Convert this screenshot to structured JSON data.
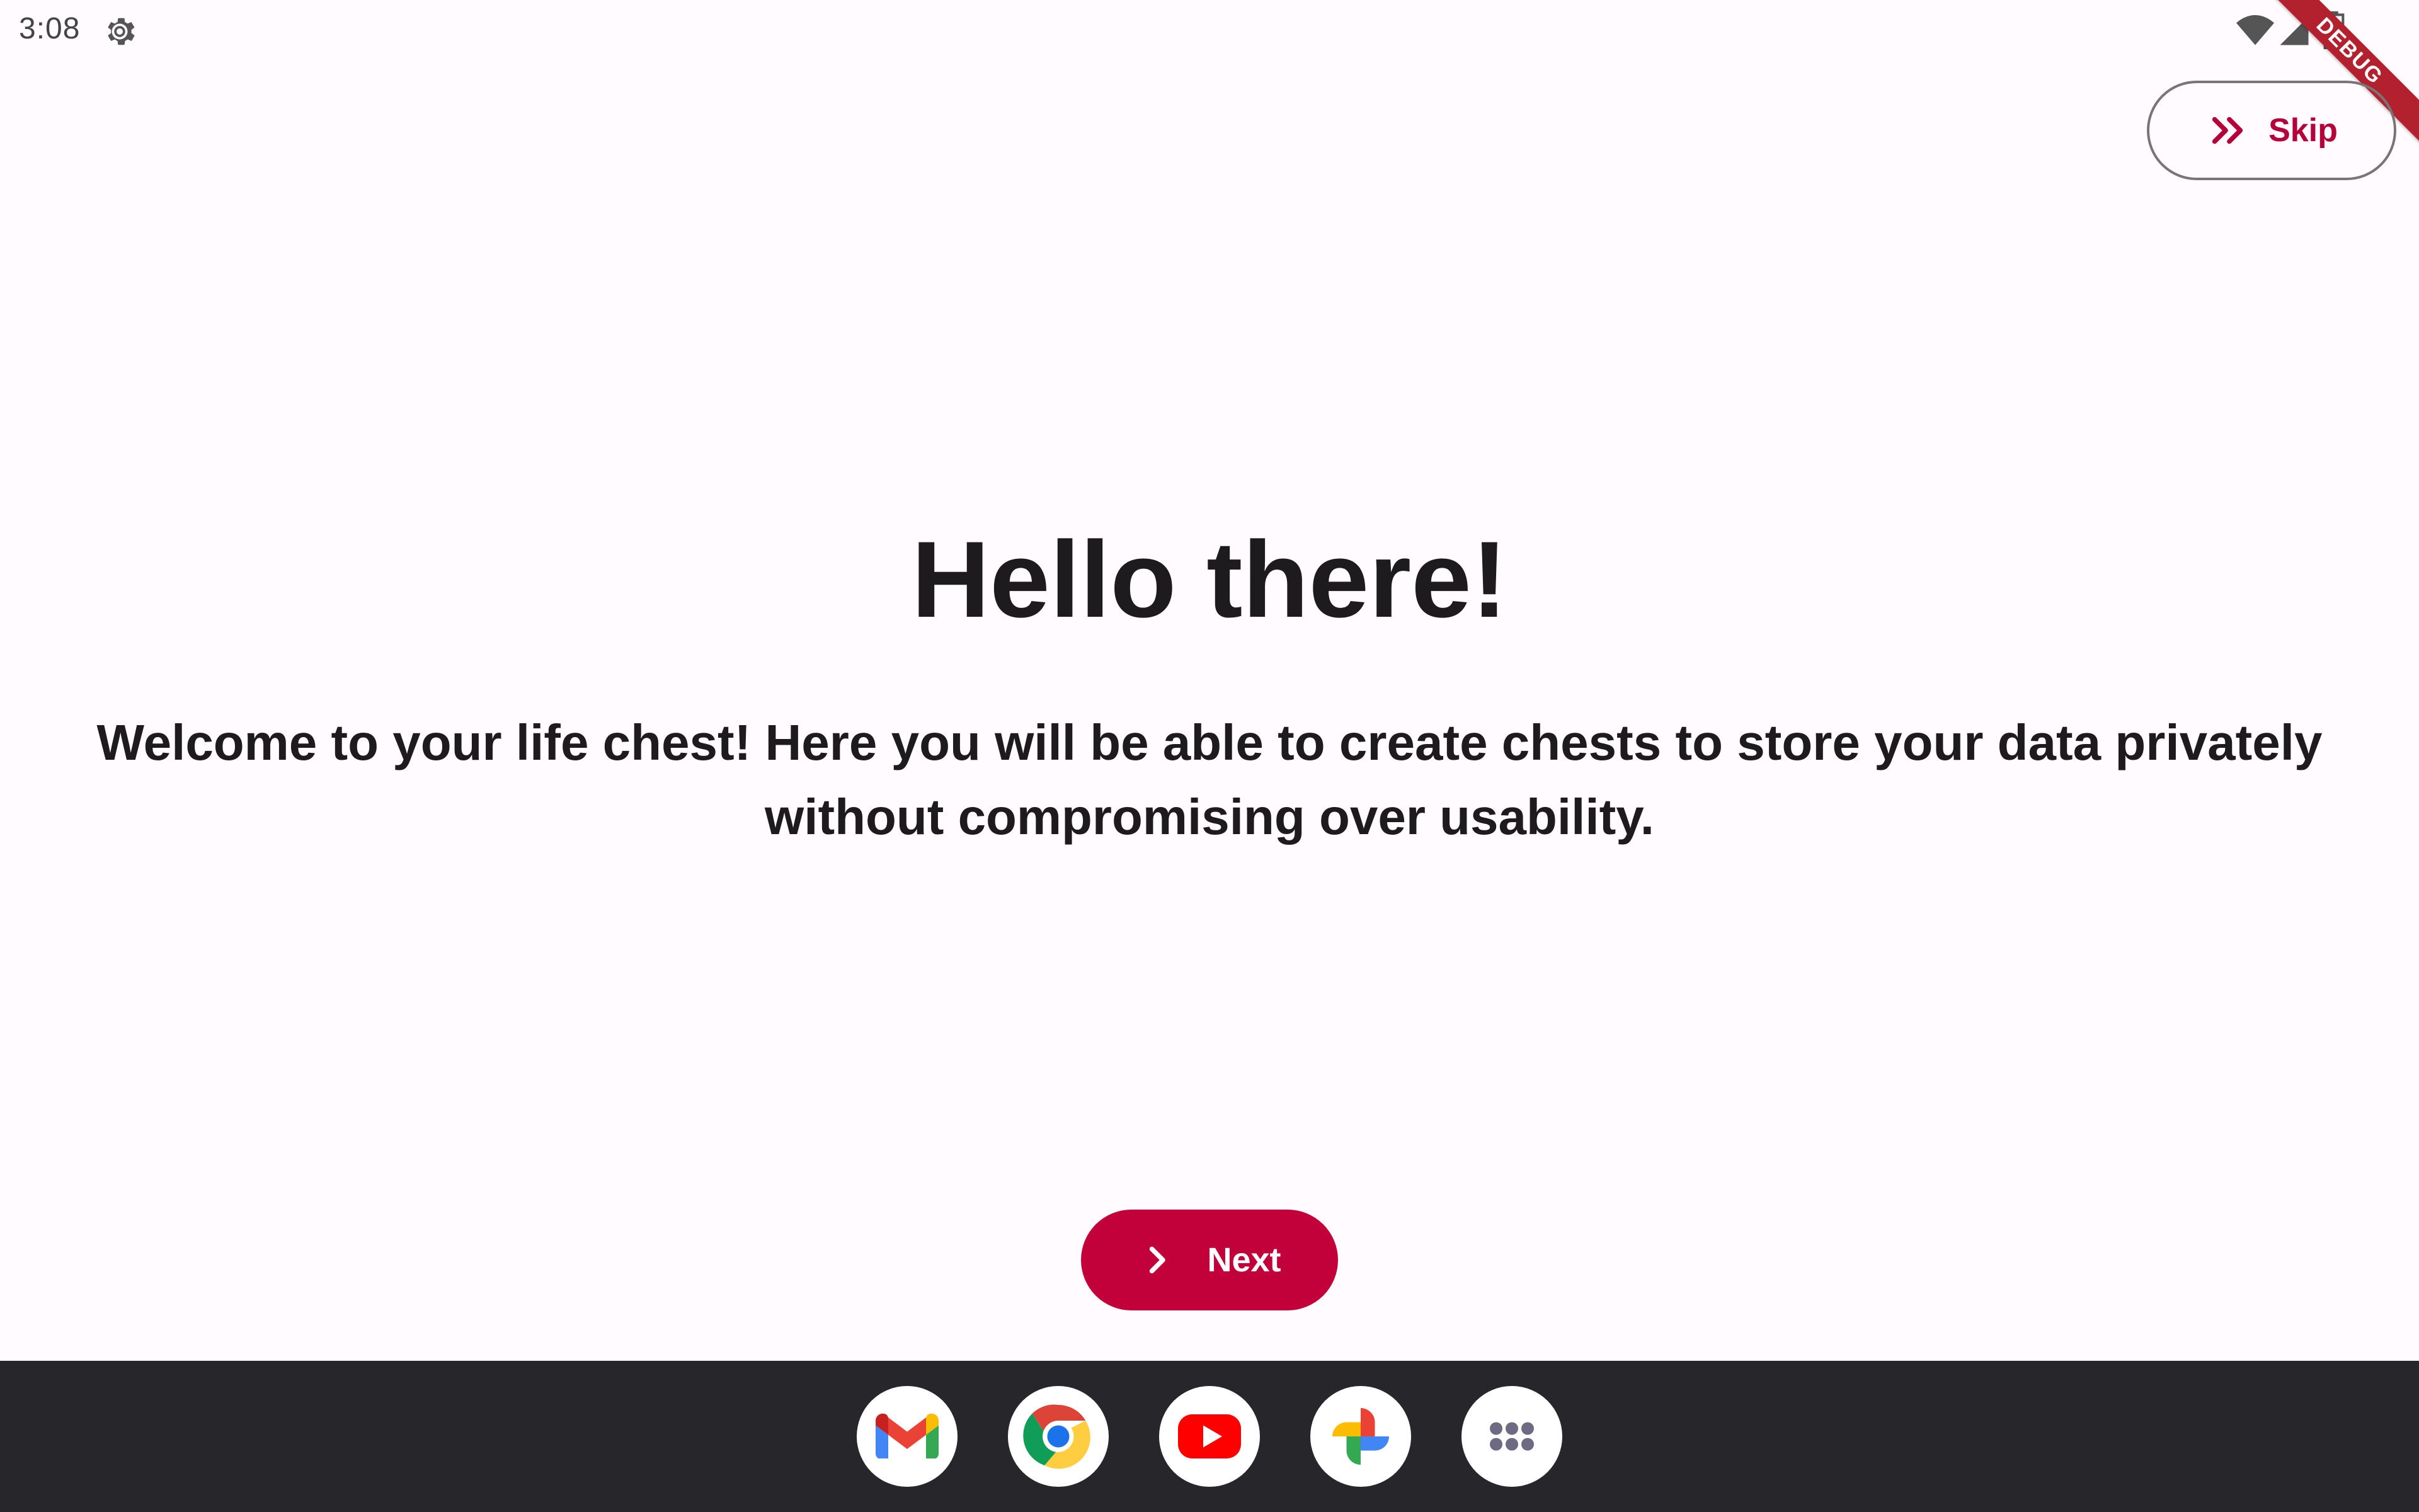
{
  "status_bar": {
    "time": "3:08",
    "icons": [
      "settings-icon",
      "wifi-icon",
      "cell-signal-icon",
      "battery-icon"
    ]
  },
  "debug_banner": {
    "label": "DEBUG"
  },
  "skip_button": {
    "label": "Skip",
    "icon": "double-chevron-right-icon"
  },
  "onboarding": {
    "headline": "Hello there!",
    "body": "Welcome to your life chest! Here you will be able to create chests to store your data privately without compromising over usability."
  },
  "next_button": {
    "label": "Next",
    "icon": "chevron-right-icon"
  },
  "taskbar": {
    "apps": [
      "gmail-icon",
      "chrome-icon",
      "youtube-icon",
      "google-photos-icon",
      "app-drawer-icon"
    ]
  },
  "colors": {
    "primary": "#c2003a",
    "skip_text": "#b5003a",
    "background": "#fffbfe",
    "taskbar": "#27262b",
    "text": "#1d1b1e",
    "debug_banner": "#b3202e"
  }
}
